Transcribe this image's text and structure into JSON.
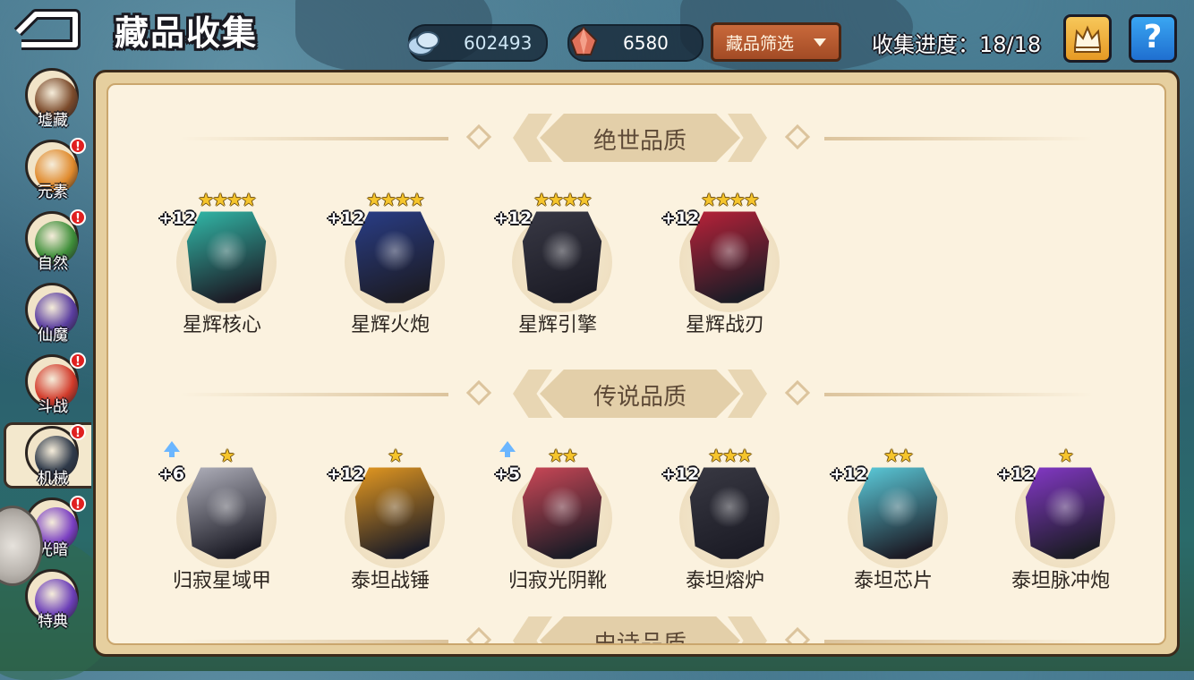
{
  "header": {
    "title": "藏品收集",
    "crystal_value": "602493",
    "gem_value": "6580",
    "filter_label": "藏品筛选",
    "progress_text": "收集进度：18/18",
    "help_label": "?"
  },
  "sidebar": {
    "items": [
      {
        "label": "墟藏",
        "alert": false,
        "color": "#7b4a2a"
      },
      {
        "label": "元素",
        "alert": true,
        "color": "#e08a2c"
      },
      {
        "label": "自然",
        "alert": true,
        "color": "#3f8f3a"
      },
      {
        "label": "仙魔",
        "alert": false,
        "color": "#5b3ea0"
      },
      {
        "label": "斗战",
        "alert": true,
        "color": "#d23b2b"
      },
      {
        "label": "机械",
        "alert": true,
        "color": "#2f3a4a",
        "selected": true
      },
      {
        "label": "光暗",
        "alert": true,
        "color": "#7a3fc2"
      },
      {
        "label": "特典",
        "alert": false,
        "color": "#6c3fb8"
      }
    ],
    "alert_mark": "!"
  },
  "sections": [
    {
      "title": "绝世品质",
      "items": [
        {
          "name": "星辉核心",
          "stars": "★★★★",
          "level": "+12",
          "upgrade": false,
          "color": "#33c2b0"
        },
        {
          "name": "星辉火炮",
          "stars": "★★★★",
          "level": "+12",
          "upgrade": false,
          "color": "#2a3f8c"
        },
        {
          "name": "星辉引擎",
          "stars": "★★★★",
          "level": "+12",
          "upgrade": false,
          "color": "#3a3a46"
        },
        {
          "name": "星辉战刃",
          "stars": "★★★★",
          "level": "+12",
          "upgrade": false,
          "color": "#c2223a"
        }
      ]
    },
    {
      "title": "传说品质",
      "items": [
        {
          "name": "归寂星域甲",
          "stars": "★",
          "level": "+6",
          "upgrade": true,
          "color": "#b9b9c4"
        },
        {
          "name": "泰坦战锤",
          "stars": "★",
          "level": "+12",
          "upgrade": false,
          "color": "#f0a020"
        },
        {
          "name": "归寂光阴靴",
          "stars": "★★",
          "level": "+5",
          "upgrade": true,
          "color": "#d64a5a"
        },
        {
          "name": "泰坦熔炉",
          "stars": "★★★",
          "level": "+12",
          "upgrade": false,
          "color": "#3a3a44"
        },
        {
          "name": "泰坦芯片",
          "stars": "★★",
          "level": "+12",
          "upgrade": false,
          "color": "#5fd6e6"
        },
        {
          "name": "泰坦脉冲炮",
          "stars": "★",
          "level": "+12",
          "upgrade": false,
          "color": "#8a3ad0"
        }
      ]
    },
    {
      "title": "史诗品质"
    }
  ]
}
